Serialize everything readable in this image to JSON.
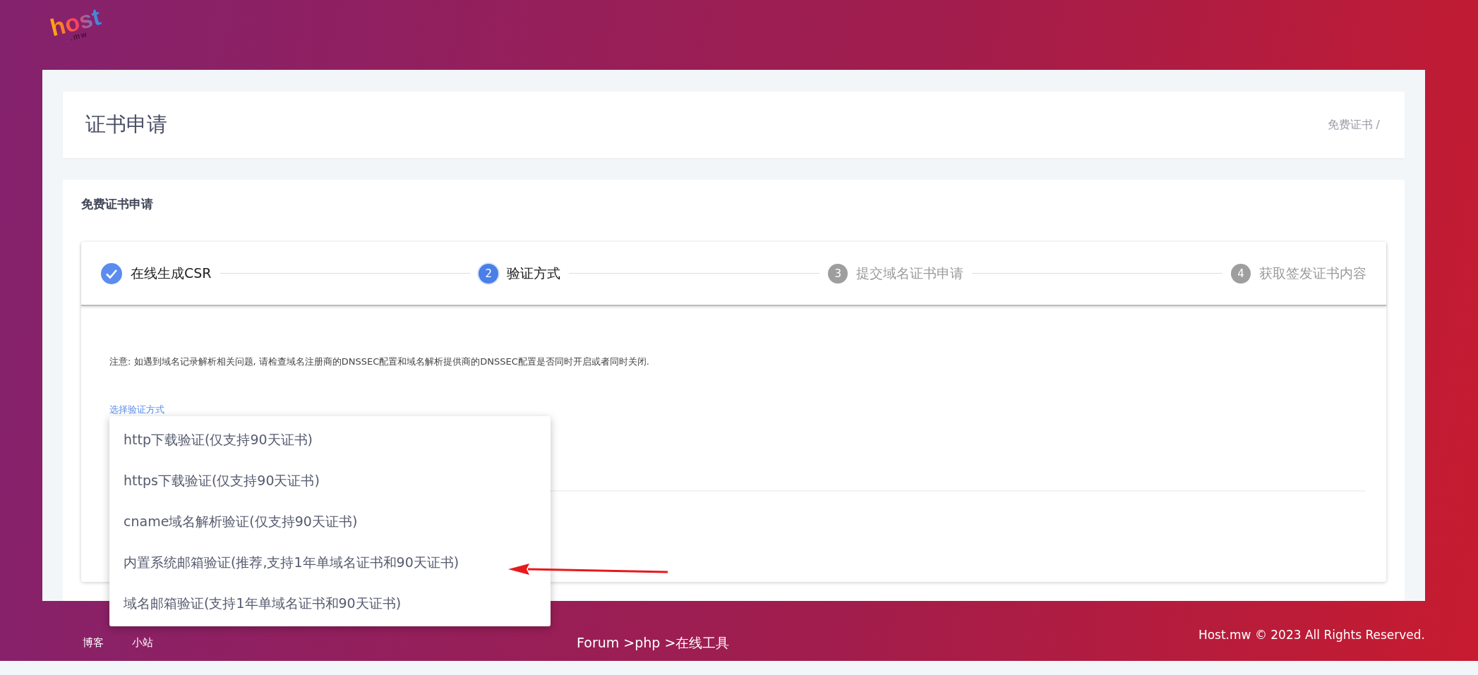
{
  "logo": {
    "name": "host",
    "suffix": ".mw"
  },
  "page_header": {
    "title": "证书申请",
    "breadcrumb": "免费证书 /"
  },
  "card": {
    "title": "免费证书申请",
    "steps": [
      {
        "label": "在线生成CSR",
        "completed": true,
        "active": false
      },
      {
        "number": "2",
        "label": "验证方式",
        "completed": false,
        "active": true
      },
      {
        "number": "3",
        "label": "提交域名证书申请",
        "completed": false,
        "active": false
      },
      {
        "number": "4",
        "label": "获取签发证书内容",
        "completed": false,
        "active": false
      }
    ],
    "notice": "注意: 如遇到域名记录解析相关问题, 请检查域名注册商的DNSSEC配置和域名解析提供商的DNSSEC配置是否同时开启或者同时关闭.",
    "select_label": "选择验证方式",
    "dropdown_options": [
      {
        "label": "http下载验证(仅支持90天证书)",
        "selected": false
      },
      {
        "label": "https下载验证(仅支持90天证书)",
        "selected": false
      },
      {
        "label": "cname域名解析验证(仅支持90天证书)",
        "selected": false
      },
      {
        "label": "内置系统邮箱验证(推荐,支持1年单域名证书和90天证书)",
        "selected": false
      },
      {
        "label": "域名邮箱验证(支持1年单域名证书和90天证书)",
        "selected": false
      }
    ]
  },
  "footer": {
    "links": [
      "博客",
      "小站"
    ],
    "breadcrumb": "Forum >php >在线工具",
    "copyright": "Host.mw © 2023 All Rights Reserved."
  }
}
